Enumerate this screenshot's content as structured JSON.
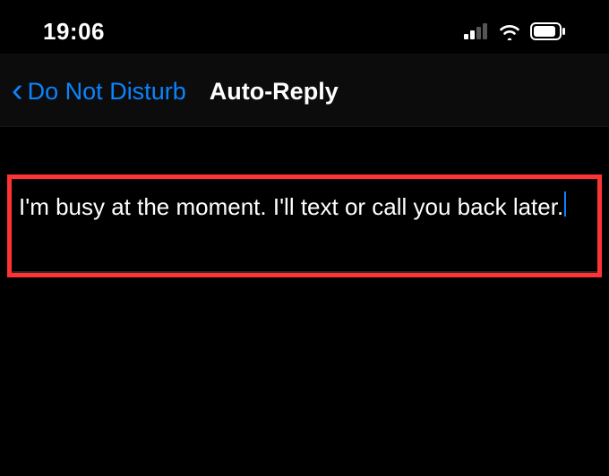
{
  "status": {
    "time": "19:06"
  },
  "nav": {
    "back_label": "Do Not Disturb",
    "title": "Auto-Reply"
  },
  "message": {
    "text": "I'm busy at the moment. I'll text or call you back later."
  }
}
